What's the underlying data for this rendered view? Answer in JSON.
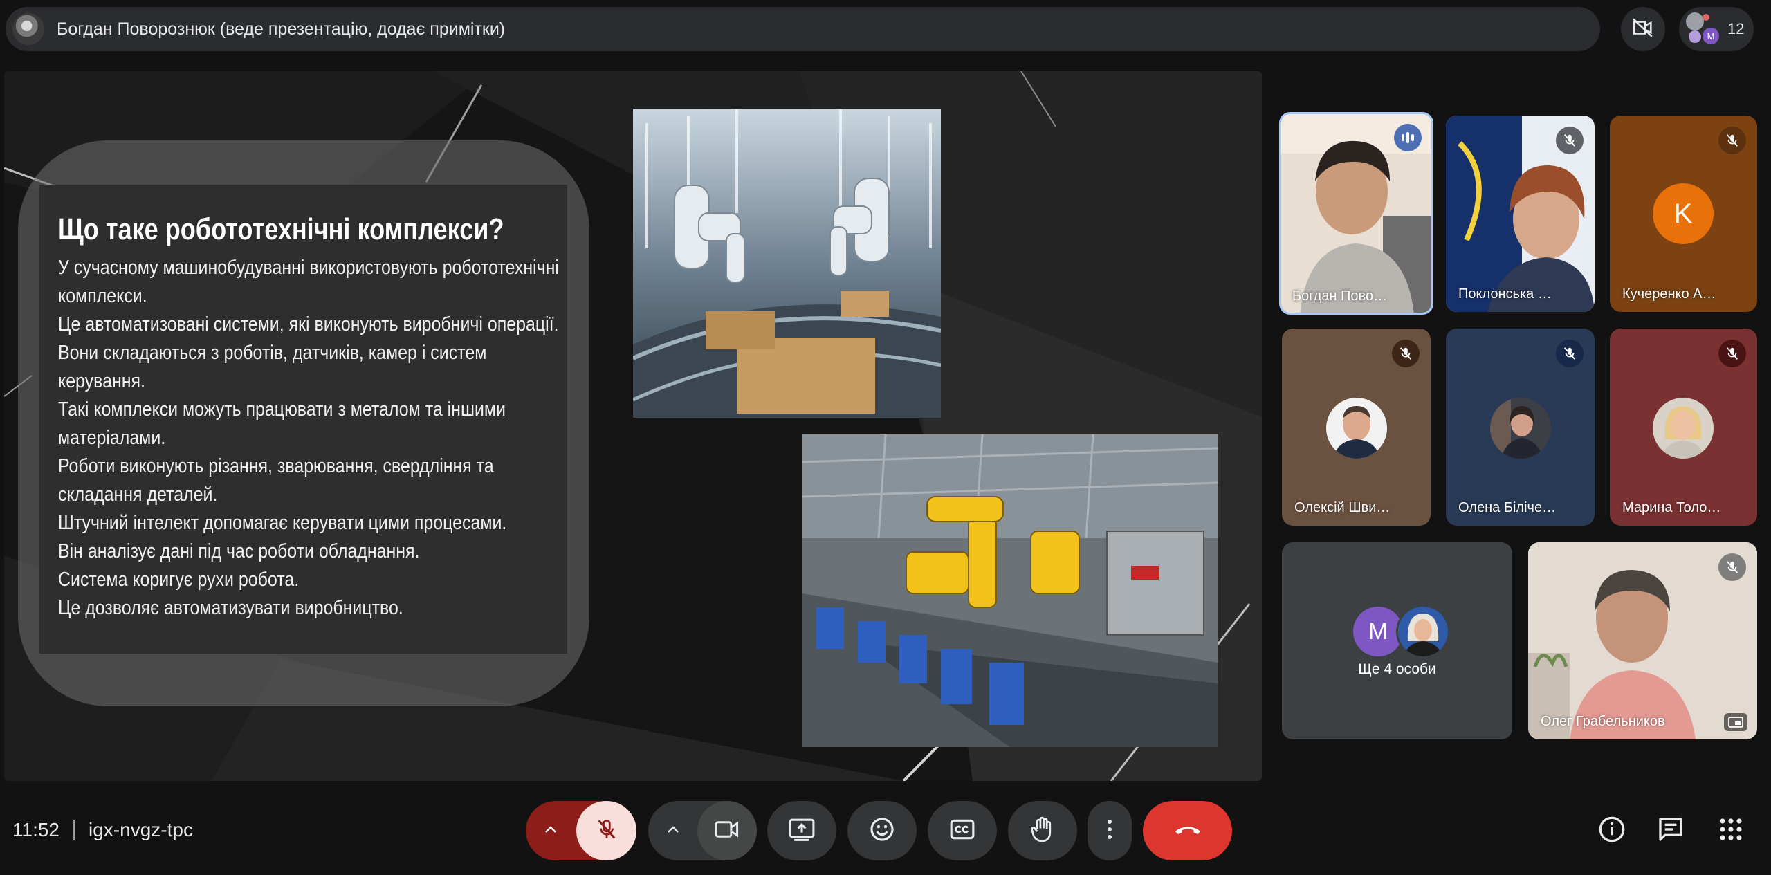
{
  "presenter_bar": {
    "title": "Богдан Поворознюк (веде презентацію, додає примітки)",
    "participant_count": "12"
  },
  "slide": {
    "title": "Що таке робототехнічні комплекси?",
    "lines": [
      "У сучасному машинобудуванні використовують робототехнічні",
      "комплекси.",
      "Це автоматизовані системи, які виконують виробничі операції.",
      "Вони складаються з роботів, датчиків, камер і систем",
      "керування.",
      "Такі комплекси можуть працювати з металом та іншими",
      "матеріалами.",
      "Роботи виконують різання, зварювання, свердління та",
      "складання деталей.",
      "Штучний інтелект допомагає керувати цими процесами.",
      "Він аналізує дані під час роботи обладнання.",
      "Система коригує рухи робота.",
      "Це дозволяє автоматизувати виробництво."
    ]
  },
  "participants": [
    {
      "name": "Богдан Пово…",
      "state": "speaking",
      "accent": "#a8c7fa"
    },
    {
      "name": "Поклонська …",
      "state": "muted"
    },
    {
      "name": "Кучеренко А…",
      "state": "muted",
      "avatar_letter": "K",
      "avatar_color": "#e8710a"
    },
    {
      "name": "Олексій Шви…",
      "state": "muted"
    },
    {
      "name": "Олена Біліче…",
      "state": "muted"
    },
    {
      "name": "Марина Толо…",
      "state": "muted"
    },
    {
      "name": "Ще 4 особи",
      "avatar_letter": "M",
      "avatar_color": "#7e57c2"
    },
    {
      "name": "Олег Грабельников",
      "state": "muted"
    }
  ],
  "meeting": {
    "time": "11:52",
    "code": "igx-nvgz-tpc"
  },
  "colors": {
    "end_call": "#dc362e",
    "mic_off_bg": "#f9dedc",
    "mic_caret_bg": "#8c1d18",
    "control_bg": "#333537"
  },
  "icons": [
    "chevron-up-icon",
    "mic-off-icon",
    "camera-icon",
    "present-icon",
    "emoji-icon",
    "captions-icon",
    "hand-icon",
    "more-icon",
    "end-call-icon",
    "info-icon",
    "chat-icon",
    "apps-icon",
    "camera-off-icon",
    "pip-icon"
  ]
}
